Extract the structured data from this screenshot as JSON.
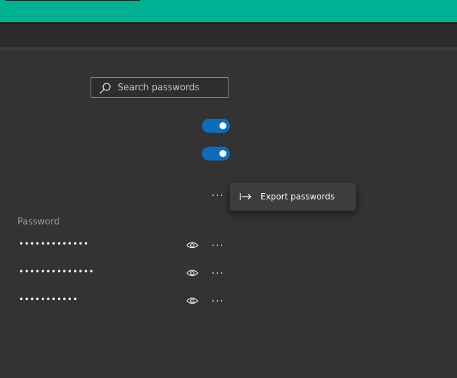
{
  "search": {
    "placeholder": "Search passwords",
    "value": ""
  },
  "settings_toggles": [
    {
      "state": "on"
    },
    {
      "state": "on"
    }
  ],
  "context_menu": {
    "items": [
      {
        "label": "Export passwords",
        "icon": "export-arrow-icon"
      }
    ]
  },
  "saved_passwords": {
    "column_header": "Password",
    "rows": [
      {
        "masked": "•••••••••••••",
        "icon": "eye-icon"
      },
      {
        "masked": "••••••••••••••",
        "icon": "eye-icon"
      },
      {
        "masked": "•••••••••••",
        "icon": "eye-icon"
      }
    ]
  },
  "colors": {
    "accent_bar": "#00b093",
    "toggle_on": "#0f6cbd",
    "background": "#333333",
    "menu_bg": "#3d3d3d"
  }
}
